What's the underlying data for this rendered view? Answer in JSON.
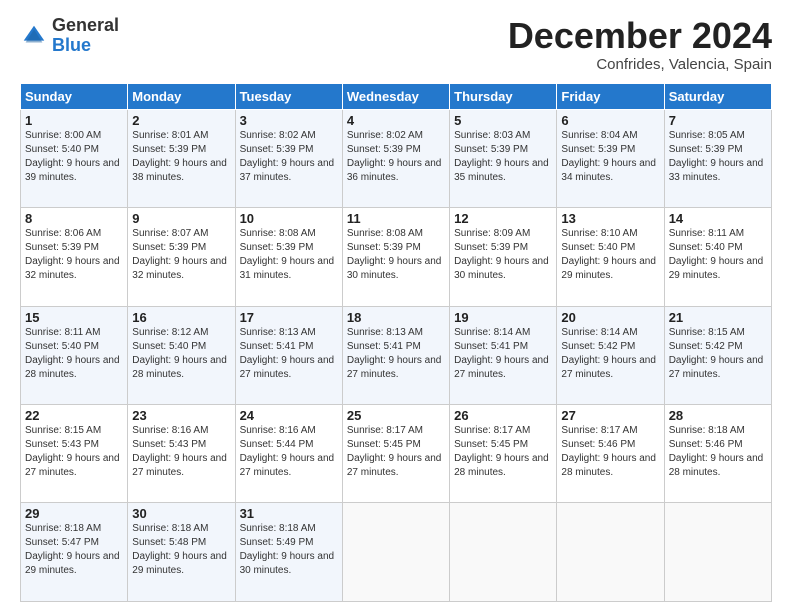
{
  "logo": {
    "general": "General",
    "blue": "Blue"
  },
  "title": "December 2024",
  "location": "Confrides, Valencia, Spain",
  "weekdays": [
    "Sunday",
    "Monday",
    "Tuesday",
    "Wednesday",
    "Thursday",
    "Friday",
    "Saturday"
  ],
  "weeks": [
    [
      {
        "day": "1",
        "sunrise": "8:00 AM",
        "sunset": "5:40 PM",
        "daylight": "9 hours and 39 minutes."
      },
      {
        "day": "2",
        "sunrise": "8:01 AM",
        "sunset": "5:39 PM",
        "daylight": "9 hours and 38 minutes."
      },
      {
        "day": "3",
        "sunrise": "8:02 AM",
        "sunset": "5:39 PM",
        "daylight": "9 hours and 37 minutes."
      },
      {
        "day": "4",
        "sunrise": "8:02 AM",
        "sunset": "5:39 PM",
        "daylight": "9 hours and 36 minutes."
      },
      {
        "day": "5",
        "sunrise": "8:03 AM",
        "sunset": "5:39 PM",
        "daylight": "9 hours and 35 minutes."
      },
      {
        "day": "6",
        "sunrise": "8:04 AM",
        "sunset": "5:39 PM",
        "daylight": "9 hours and 34 minutes."
      },
      {
        "day": "7",
        "sunrise": "8:05 AM",
        "sunset": "5:39 PM",
        "daylight": "9 hours and 33 minutes."
      }
    ],
    [
      {
        "day": "8",
        "sunrise": "8:06 AM",
        "sunset": "5:39 PM",
        "daylight": "9 hours and 32 minutes."
      },
      {
        "day": "9",
        "sunrise": "8:07 AM",
        "sunset": "5:39 PM",
        "daylight": "9 hours and 32 minutes."
      },
      {
        "day": "10",
        "sunrise": "8:08 AM",
        "sunset": "5:39 PM",
        "daylight": "9 hours and 31 minutes."
      },
      {
        "day": "11",
        "sunrise": "8:08 AM",
        "sunset": "5:39 PM",
        "daylight": "9 hours and 30 minutes."
      },
      {
        "day": "12",
        "sunrise": "8:09 AM",
        "sunset": "5:39 PM",
        "daylight": "9 hours and 30 minutes."
      },
      {
        "day": "13",
        "sunrise": "8:10 AM",
        "sunset": "5:40 PM",
        "daylight": "9 hours and 29 minutes."
      },
      {
        "day": "14",
        "sunrise": "8:11 AM",
        "sunset": "5:40 PM",
        "daylight": "9 hours and 29 minutes."
      }
    ],
    [
      {
        "day": "15",
        "sunrise": "8:11 AM",
        "sunset": "5:40 PM",
        "daylight": "9 hours and 28 minutes."
      },
      {
        "day": "16",
        "sunrise": "8:12 AM",
        "sunset": "5:40 PM",
        "daylight": "9 hours and 28 minutes."
      },
      {
        "day": "17",
        "sunrise": "8:13 AM",
        "sunset": "5:41 PM",
        "daylight": "9 hours and 27 minutes."
      },
      {
        "day": "18",
        "sunrise": "8:13 AM",
        "sunset": "5:41 PM",
        "daylight": "9 hours and 27 minutes."
      },
      {
        "day": "19",
        "sunrise": "8:14 AM",
        "sunset": "5:41 PM",
        "daylight": "9 hours and 27 minutes."
      },
      {
        "day": "20",
        "sunrise": "8:14 AM",
        "sunset": "5:42 PM",
        "daylight": "9 hours and 27 minutes."
      },
      {
        "day": "21",
        "sunrise": "8:15 AM",
        "sunset": "5:42 PM",
        "daylight": "9 hours and 27 minutes."
      }
    ],
    [
      {
        "day": "22",
        "sunrise": "8:15 AM",
        "sunset": "5:43 PM",
        "daylight": "9 hours and 27 minutes."
      },
      {
        "day": "23",
        "sunrise": "8:16 AM",
        "sunset": "5:43 PM",
        "daylight": "9 hours and 27 minutes."
      },
      {
        "day": "24",
        "sunrise": "8:16 AM",
        "sunset": "5:44 PM",
        "daylight": "9 hours and 27 minutes."
      },
      {
        "day": "25",
        "sunrise": "8:17 AM",
        "sunset": "5:45 PM",
        "daylight": "9 hours and 27 minutes."
      },
      {
        "day": "26",
        "sunrise": "8:17 AM",
        "sunset": "5:45 PM",
        "daylight": "9 hours and 28 minutes."
      },
      {
        "day": "27",
        "sunrise": "8:17 AM",
        "sunset": "5:46 PM",
        "daylight": "9 hours and 28 minutes."
      },
      {
        "day": "28",
        "sunrise": "8:18 AM",
        "sunset": "5:46 PM",
        "daylight": "9 hours and 28 minutes."
      }
    ],
    [
      {
        "day": "29",
        "sunrise": "8:18 AM",
        "sunset": "5:47 PM",
        "daylight": "9 hours and 29 minutes."
      },
      {
        "day": "30",
        "sunrise": "8:18 AM",
        "sunset": "5:48 PM",
        "daylight": "9 hours and 29 minutes."
      },
      {
        "day": "31",
        "sunrise": "8:18 AM",
        "sunset": "5:49 PM",
        "daylight": "9 hours and 30 minutes."
      },
      null,
      null,
      null,
      null
    ]
  ],
  "labels": {
    "sunrise": "Sunrise:",
    "sunset": "Sunset:",
    "daylight": "Daylight:"
  }
}
